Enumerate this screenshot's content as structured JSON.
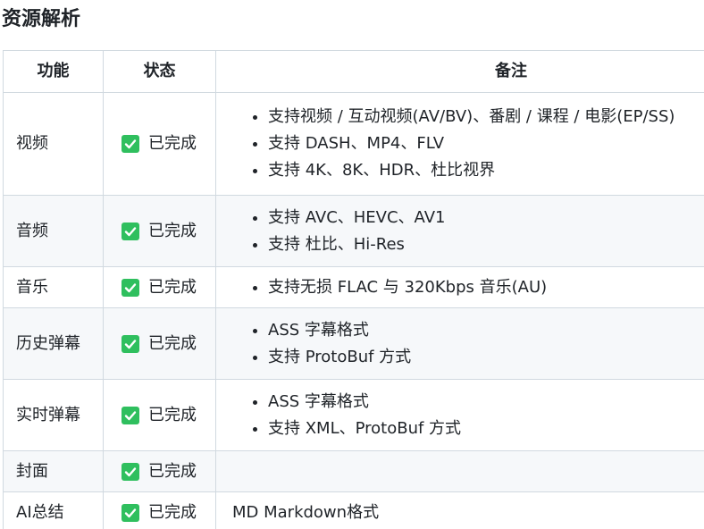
{
  "heading": "资源解析",
  "table": {
    "headers": {
      "feature": "功能",
      "status": "状态",
      "notes": "备注"
    },
    "rows": [
      {
        "feature": "视频",
        "status": "已完成",
        "notes": [
          "支持视频 / 互动视频(AV/BV)、番剧 / 课程 / 电影(EP/SS)",
          "支持 DASH、MP4、FLV",
          "支持 4K、8K、HDR、杜比视界"
        ]
      },
      {
        "feature": "音频",
        "status": "已完成",
        "notes": [
          "支持 AVC、HEVC、AV1",
          "支持 杜比、Hi-Res"
        ]
      },
      {
        "feature": "音乐",
        "status": "已完成",
        "notes": [
          "支持无损 FLAC 与 320Kbps 音乐(AU)"
        ]
      },
      {
        "feature": "历史弹幕",
        "status": "已完成",
        "notes": [
          "ASS 字幕格式",
          "支持 ProtoBuf 方式"
        ]
      },
      {
        "feature": "实时弹幕",
        "status": "已完成",
        "notes": [
          "ASS 字幕格式",
          "支持 XML、ProtoBuf 方式"
        ]
      },
      {
        "feature": "封面",
        "status": "已完成",
        "notes": []
      },
      {
        "feature": "AI总结",
        "status": "已完成",
        "note_text": "MD Markdown格式"
      }
    ]
  },
  "colors": {
    "check_green": "#2fbf5e",
    "border": "#d1d9e0",
    "alt_row": "#f6f8fa"
  },
  "icons": {
    "status": "check-box-icon"
  }
}
